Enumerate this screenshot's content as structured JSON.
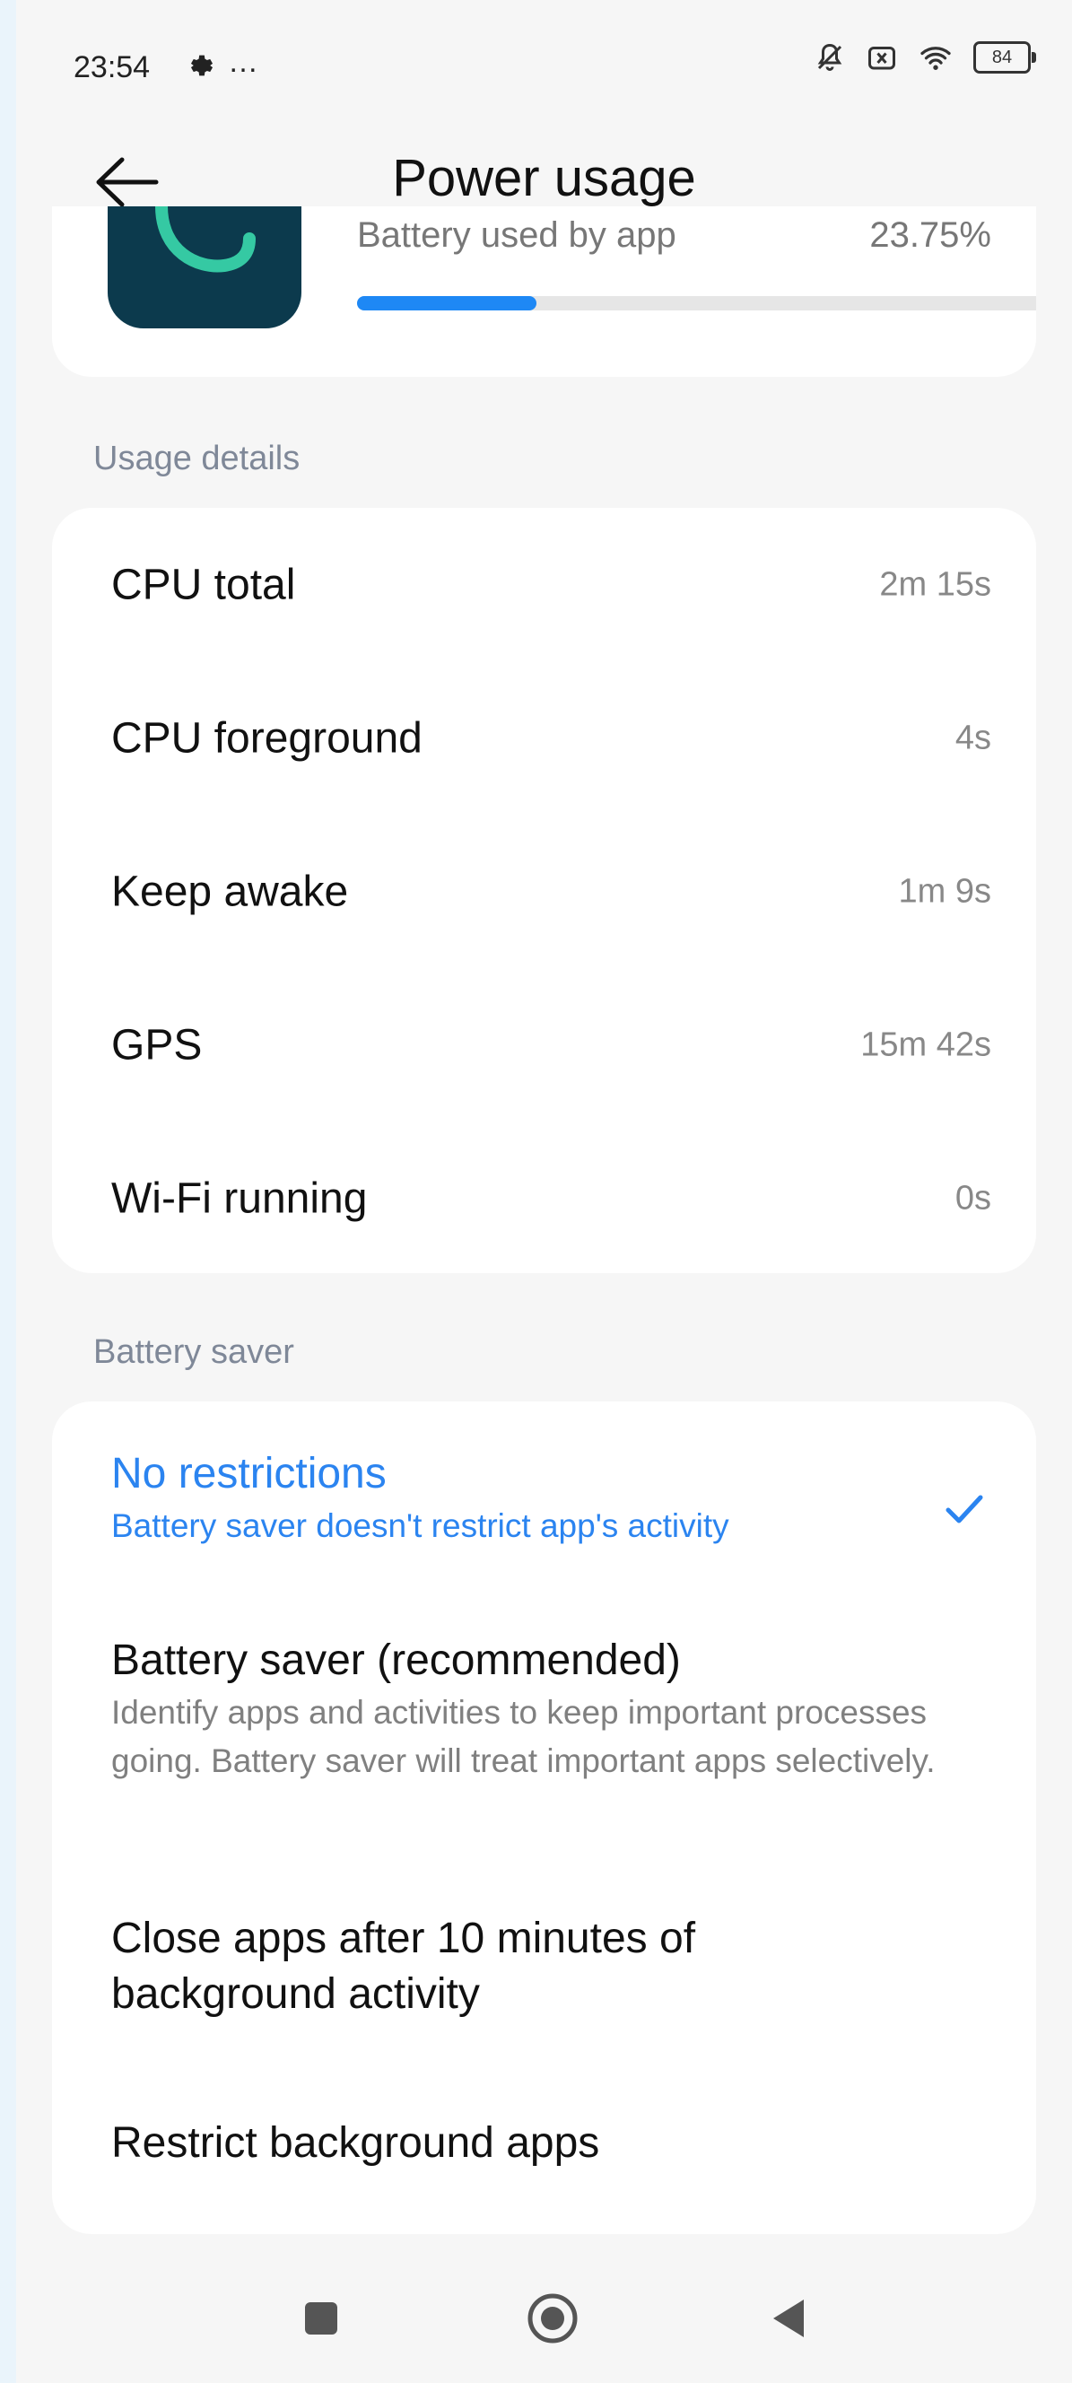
{
  "status_bar": {
    "time": "23:54",
    "settings_icon": "gear-icon",
    "more_icon": "…",
    "battery_level": "84",
    "icons": [
      "silent-icon",
      "sim-off-icon",
      "wifi-icon",
      "battery-icon"
    ]
  },
  "header": {
    "title": "Power usage",
    "back_icon": "arrow-left-icon"
  },
  "app_summary": {
    "used_label": "Battery used by app",
    "used_value": "23.75%",
    "progress_fraction": 0.26,
    "accent_color": "#1e88f5"
  },
  "usage_section": {
    "header": "Usage details",
    "rows": [
      {
        "label": "CPU total",
        "value": "2m 15s"
      },
      {
        "label": "CPU foreground",
        "value": "4s"
      },
      {
        "label": "Keep awake",
        "value": "1m 9s"
      },
      {
        "label": "GPS",
        "value": "15m 42s"
      },
      {
        "label": "Wi-Fi running",
        "value": "0s"
      }
    ]
  },
  "saver_section": {
    "header": "Battery saver",
    "options": [
      {
        "title": "No restrictions",
        "subtitle": "Battery saver doesn't restrict app's activity",
        "selected": true
      },
      {
        "title": "Battery saver (recommended)",
        "subtitle": "Identify apps and activities to keep important processes going. Battery saver will treat important apps selectively.",
        "selected": false
      },
      {
        "title": "Close apps after 10 minutes of background activity",
        "subtitle": "",
        "selected": false
      },
      {
        "title": "Restrict background apps",
        "subtitle": "",
        "selected": false
      }
    ],
    "selected_color": "#2b84f0"
  },
  "nav_bar": {
    "buttons": [
      "recents-square-icon",
      "home-circle-icon",
      "back-triangle-icon"
    ]
  }
}
